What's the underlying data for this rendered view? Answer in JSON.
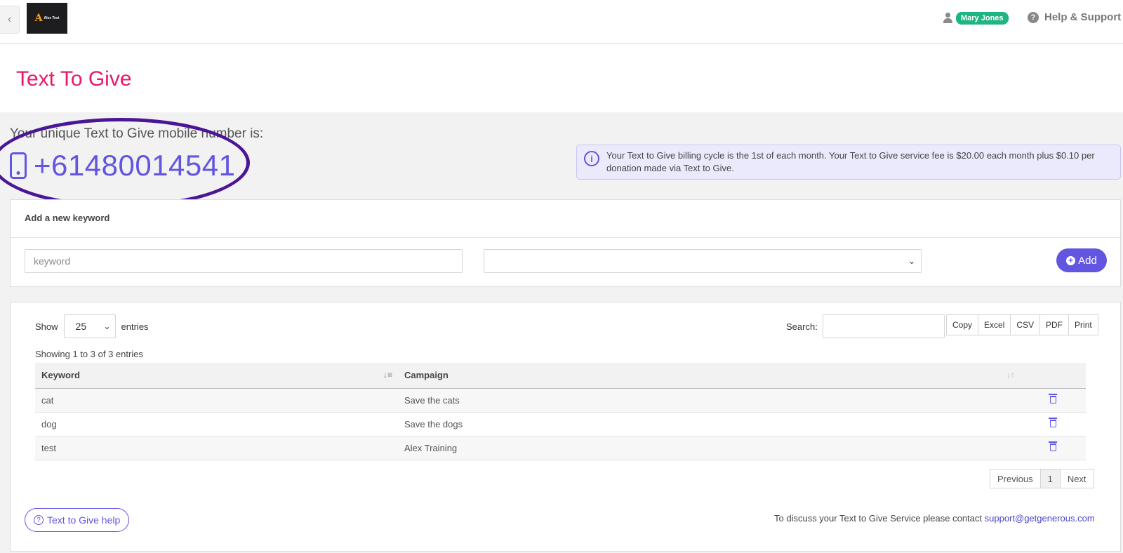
{
  "topbar": {
    "back_glyph": "‹",
    "logo_mark": "A",
    "logo_text": "Alex Test",
    "user_name": "Mary Jones",
    "help_label": "Help & Support"
  },
  "page": {
    "title": "Text To Give"
  },
  "number": {
    "label": "Your unique Text to Give mobile number is:",
    "value": "+61480014541"
  },
  "info": {
    "text": "Your Text to Give billing cycle is the 1st of each month. Your Text to Give service fee is $20.00 each month plus $0.10 per donation made via Text to Give."
  },
  "add_keyword": {
    "heading": "Add a new keyword",
    "keyword_placeholder": "keyword",
    "campaign_value": "",
    "add_label": "Add"
  },
  "table_controls": {
    "show_label": "Show",
    "page_length": "25",
    "entries_label": "entries",
    "search_label": "Search:",
    "search_value": "",
    "export_buttons": [
      "Copy",
      "Excel",
      "CSV",
      "PDF",
      "Print"
    ],
    "showing_text": "Showing 1 to 3 of 3 entries"
  },
  "table": {
    "columns": [
      "Keyword",
      "Campaign"
    ],
    "rows": [
      {
        "keyword": "cat",
        "campaign": "Save the cats"
      },
      {
        "keyword": "dog",
        "campaign": "Save the dogs"
      },
      {
        "keyword": "test",
        "campaign": "Alex Training"
      }
    ]
  },
  "pagination": {
    "previous": "Previous",
    "current": "1",
    "next": "Next"
  },
  "footer": {
    "help_button": "Text to Give help",
    "contact_text": "To discuss your Text to Give Service please contact",
    "contact_email": "support@getgenerous.com"
  },
  "colors": {
    "accent": "#6255e0",
    "title": "#e8196b",
    "user_badge": "#1fb583",
    "highlight_ellipse": "#4b1696"
  }
}
